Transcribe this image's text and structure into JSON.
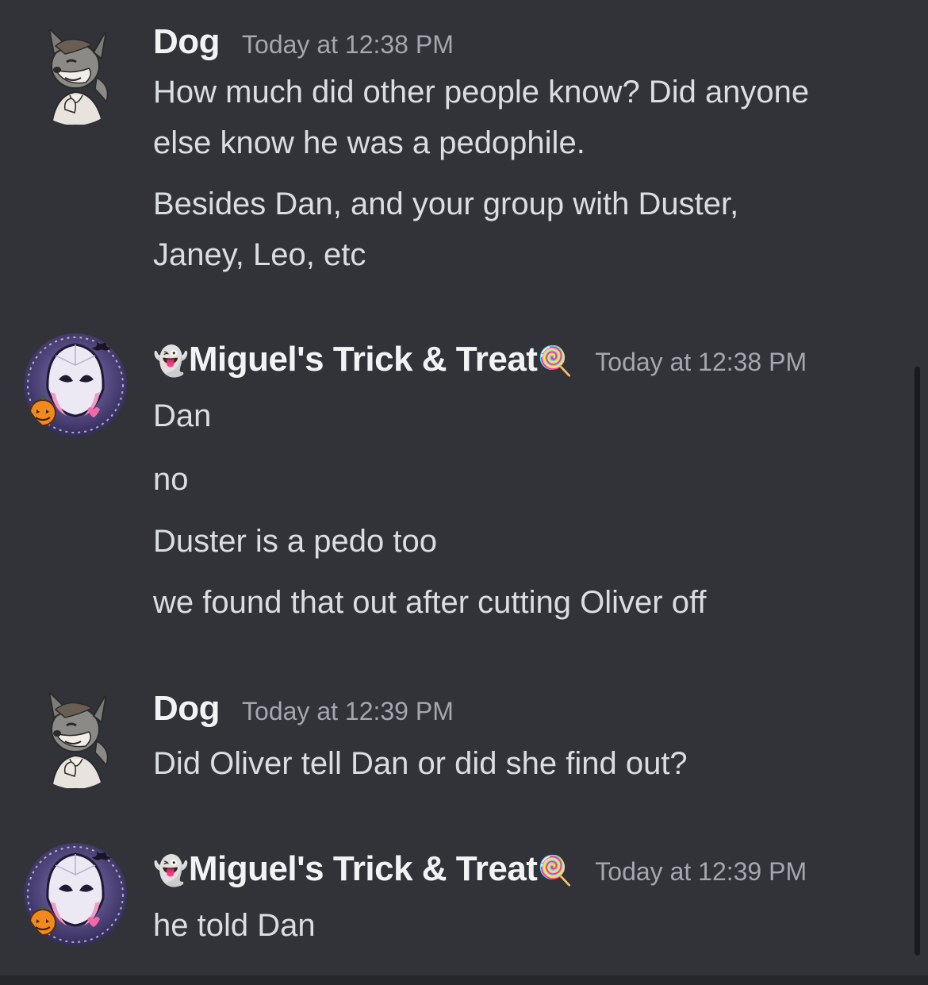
{
  "messages": [
    {
      "author": "Dog",
      "timestamp": "Today at 12:38 PM",
      "lines": [
        "How much did other people know? Did anyone",
        "else know he was a pedophile.",
        "Besides Dan, and your group with Duster,",
        "Janey, Leo, etc"
      ]
    },
    {
      "author": "Miguel's Trick & Treat",
      "author_prefix_emoji": "👻",
      "author_suffix_emoji": "🍭",
      "timestamp": "Today at 12:38 PM",
      "lines": [
        "Dan",
        "no",
        "Duster is a pedo too",
        "we found that out after cutting Oliver off"
      ]
    },
    {
      "author": "Dog",
      "timestamp": "Today at 12:39 PM",
      "lines": [
        "Did Oliver tell Dan or did she find out?"
      ]
    },
    {
      "author": "Miguel's Trick & Treat",
      "author_prefix_emoji": "👻",
      "author_suffix_emoji": "🍭",
      "timestamp": "Today at 12:39 PM",
      "lines": [
        "he told Dan"
      ]
    }
  ],
  "colors": {
    "background": "#313338",
    "username": "#f2f3f5",
    "text": "#dbdee1",
    "timestamp": "#a4a7ad"
  },
  "icons": {
    "dog_avatar": "wolf-character-avatar",
    "miguel_avatar": "ghost-spider-halloween-avatar"
  }
}
